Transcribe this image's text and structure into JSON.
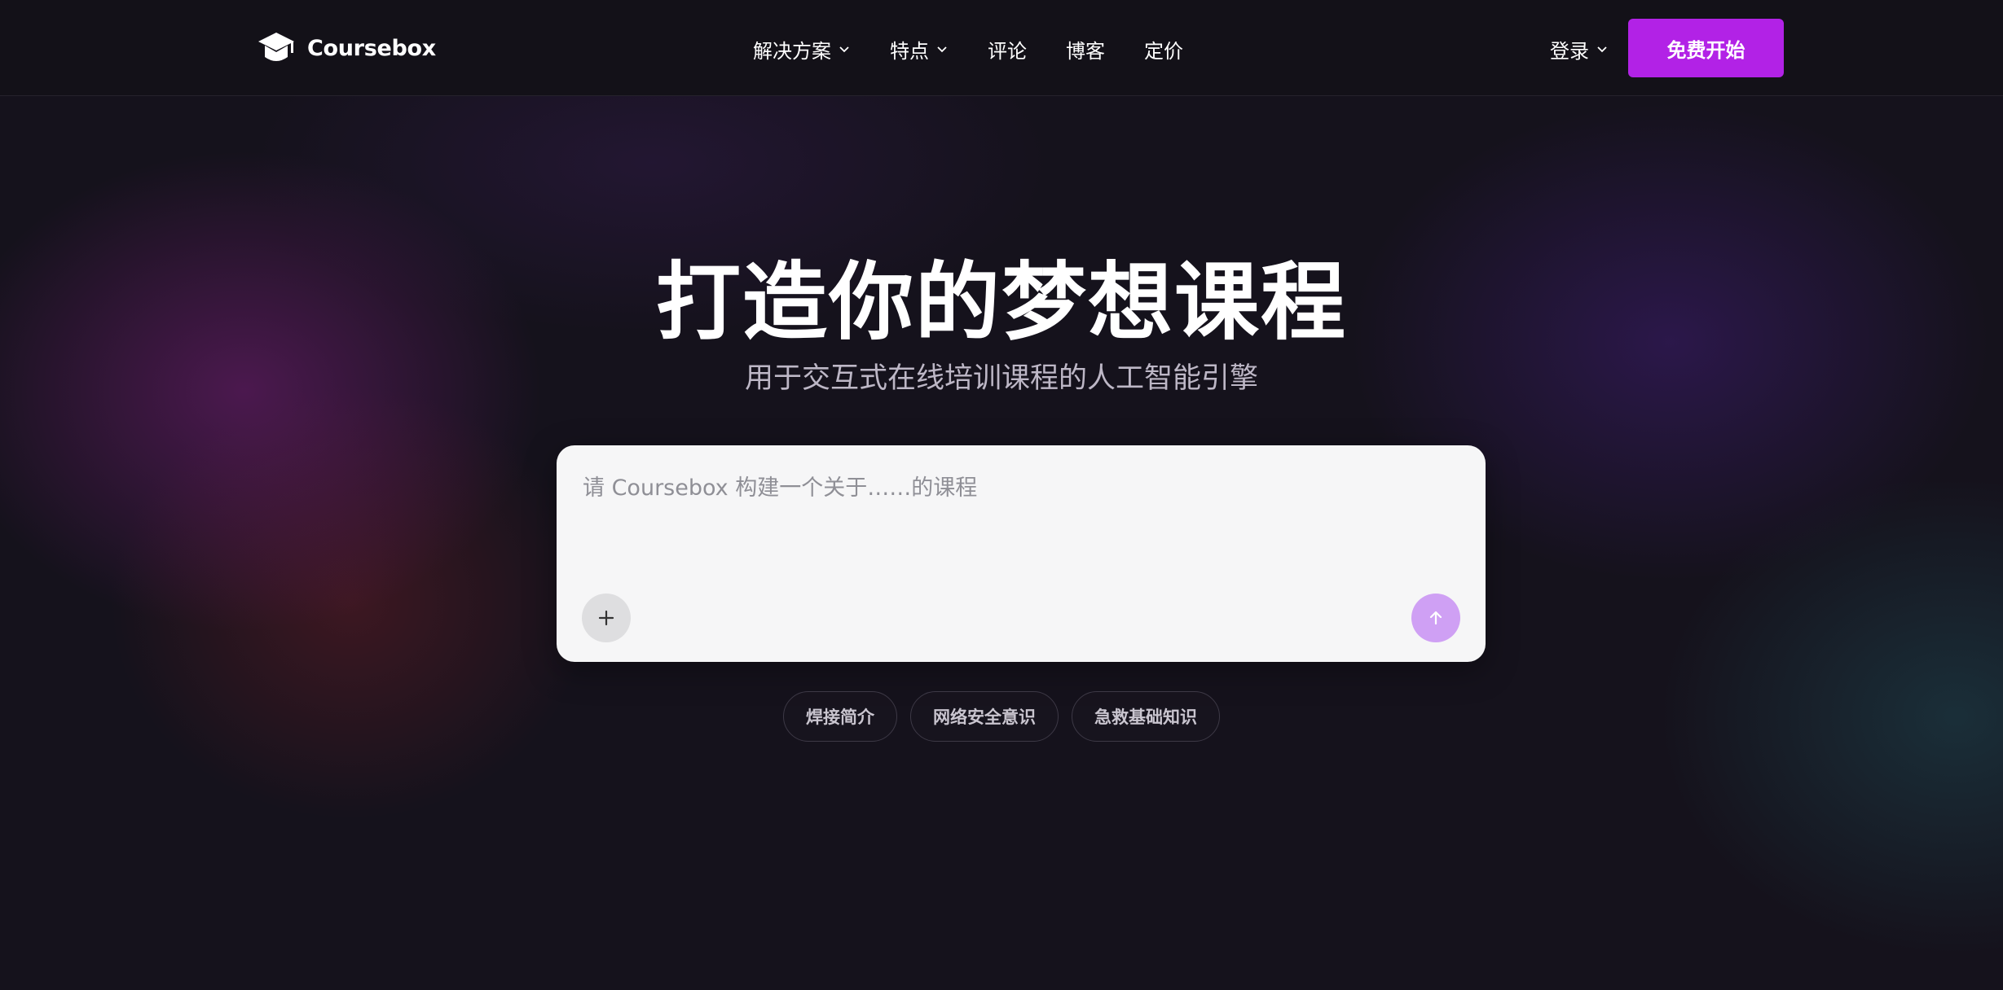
{
  "nav": {
    "logo_text": "Coursebox",
    "menu": [
      {
        "label": "解决方案",
        "dropdown": true
      },
      {
        "label": "特点",
        "dropdown": true
      },
      {
        "label": "评论",
        "dropdown": false
      },
      {
        "label": "博客",
        "dropdown": false
      },
      {
        "label": "定价",
        "dropdown": false
      }
    ],
    "login_label": "登录",
    "cta_label": "免费开始"
  },
  "hero": {
    "title": "打造你的梦想课程",
    "subtitle": "用于交互式在线培训课程的人工智能引擎"
  },
  "prompt": {
    "placeholder": "请 Coursebox 构建一个关于……的课程",
    "value": ""
  },
  "suggestions": [
    "焊接简介",
    "网络安全意识",
    "急救基础知识"
  ],
  "colors": {
    "accent": "#b222e6",
    "send_button": "#cfa0f4",
    "background": "#15121c"
  }
}
